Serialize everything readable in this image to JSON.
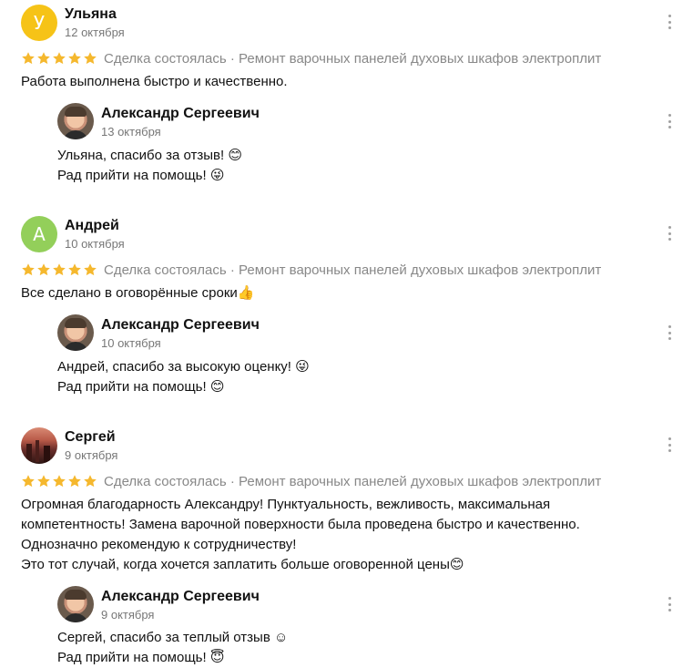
{
  "rating_stars": 5,
  "star_color": "#F5B82E",
  "reviews": [
    {
      "author": "Ульяна",
      "avatar_letter": "У",
      "avatar_color": "#F6C317",
      "date": "12 октября",
      "meta": "Сделка состоялась · Ремонт варочных панелей духовых шкафов электроплит",
      "text": "Работа выполнена быстро и качественно.",
      "reply": {
        "author": "Александр Сергеевич",
        "date": "13 октября",
        "text": "Ульяна, спасибо за отзыв! 😊\nРад прийти на помощь! 😜"
      }
    },
    {
      "author": "Андрей",
      "avatar_letter": "А",
      "avatar_color": "#93CF5A",
      "date": "10 октября",
      "meta": "Сделка состоялась · Ремонт варочных панелей духовых шкафов электроплит",
      "text": "Все сделано в оговорённые сроки👍",
      "reply": {
        "author": "Александр Сергеевич",
        "date": "10 октября",
        "text": "Андрей, спасибо за высокую оценку! 😜\nРад прийти на помощь! 😊"
      }
    },
    {
      "author": "Сергей",
      "avatar_letter": "",
      "avatar_color": "#8a3a30",
      "date": "9 октября",
      "meta": "Сделка состоялась · Ремонт варочных панелей духовых шкафов электроплит",
      "text": "Огромная благодарность Александру! Пунктуальность, вежливость, максимальная\nкомпетентность! Замена варочной поверхности была проведена быстро и качественно.\nОднозначно рекомендую к сотрудничеству!\nЭто тот случай, когда хочется заплатить больше оговоренной цены😊",
      "reply": {
        "author": "Александр Сергеевич",
        "date": "9 октября",
        "text": "Сергей, спасибо за теплый отзыв ☺\nРад прийти на помощь! 😇"
      }
    }
  ]
}
